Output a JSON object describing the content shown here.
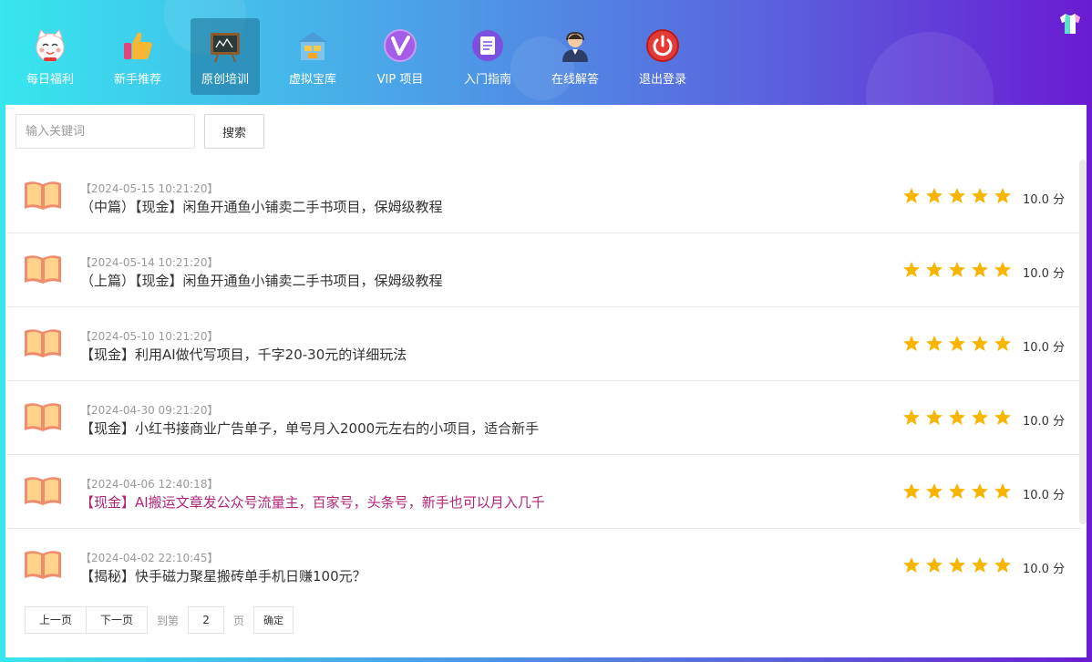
{
  "nav": {
    "items": [
      {
        "label": "每日福利",
        "icon": "lucky-cat-icon",
        "active": false
      },
      {
        "label": "新手推荐",
        "icon": "thumbs-up-icon",
        "active": false
      },
      {
        "label": "原创培训",
        "icon": "blackboard-icon",
        "active": true
      },
      {
        "label": "虚拟宝库",
        "icon": "treasure-house-icon",
        "active": false
      },
      {
        "label": "VIP 项目",
        "icon": "vip-icon",
        "active": false
      },
      {
        "label": "入门指南",
        "icon": "document-icon",
        "active": false
      },
      {
        "label": "在线解答",
        "icon": "support-agent-icon",
        "active": false
      },
      {
        "label": "退出登录",
        "icon": "power-icon",
        "active": false
      }
    ]
  },
  "search": {
    "placeholder": "输入关键词",
    "button_label": "搜索"
  },
  "articles": [
    {
      "date": "【2024-05-15 10:21:20】",
      "title": "（中篇）【现金】闲鱼开通鱼小铺卖二手书项目，保姆级教程",
      "rating": 5,
      "score": "10.0 分",
      "highlight": false
    },
    {
      "date": "【2024-05-14 10:21:20】",
      "title": "（上篇）【现金】闲鱼开通鱼小铺卖二手书项目，保姆级教程",
      "rating": 5,
      "score": "10.0 分",
      "highlight": false
    },
    {
      "date": "【2024-05-10 10:21:20】",
      "title": "【现金】利用AI做代写项目，千字20-30元的详细玩法",
      "rating": 5,
      "score": "10.0 分",
      "highlight": false
    },
    {
      "date": "【2024-04-30 09:21:20】",
      "title": "【现金】小红书接商业广告单子，单号月入2000元左右的小项目，适合新手",
      "rating": 5,
      "score": "10.0 分",
      "highlight": false
    },
    {
      "date": "【2024-04-06 12:40:18】",
      "title": "【现金】AI搬运文章发公众号流量主，百家号，头条号，新手也可以月入几千",
      "rating": 5,
      "score": "10.0 分",
      "highlight": true
    },
    {
      "date": "【2024-04-02 22:10:45】",
      "title": "【揭秘】快手磁力聚星搬砖单手机日赚100元？",
      "rating": 5,
      "score": "10.0 分",
      "highlight": false
    }
  ],
  "pager": {
    "prev_label": "上一页",
    "next_label": "下一页",
    "goto_prefix": "到第",
    "page_value": "2",
    "goto_suffix": "页",
    "confirm_label": "确定"
  },
  "colors": {
    "star": "#f7b500",
    "highlight_title": "#b0247a",
    "active_nav_bg": "#1e6e96"
  }
}
